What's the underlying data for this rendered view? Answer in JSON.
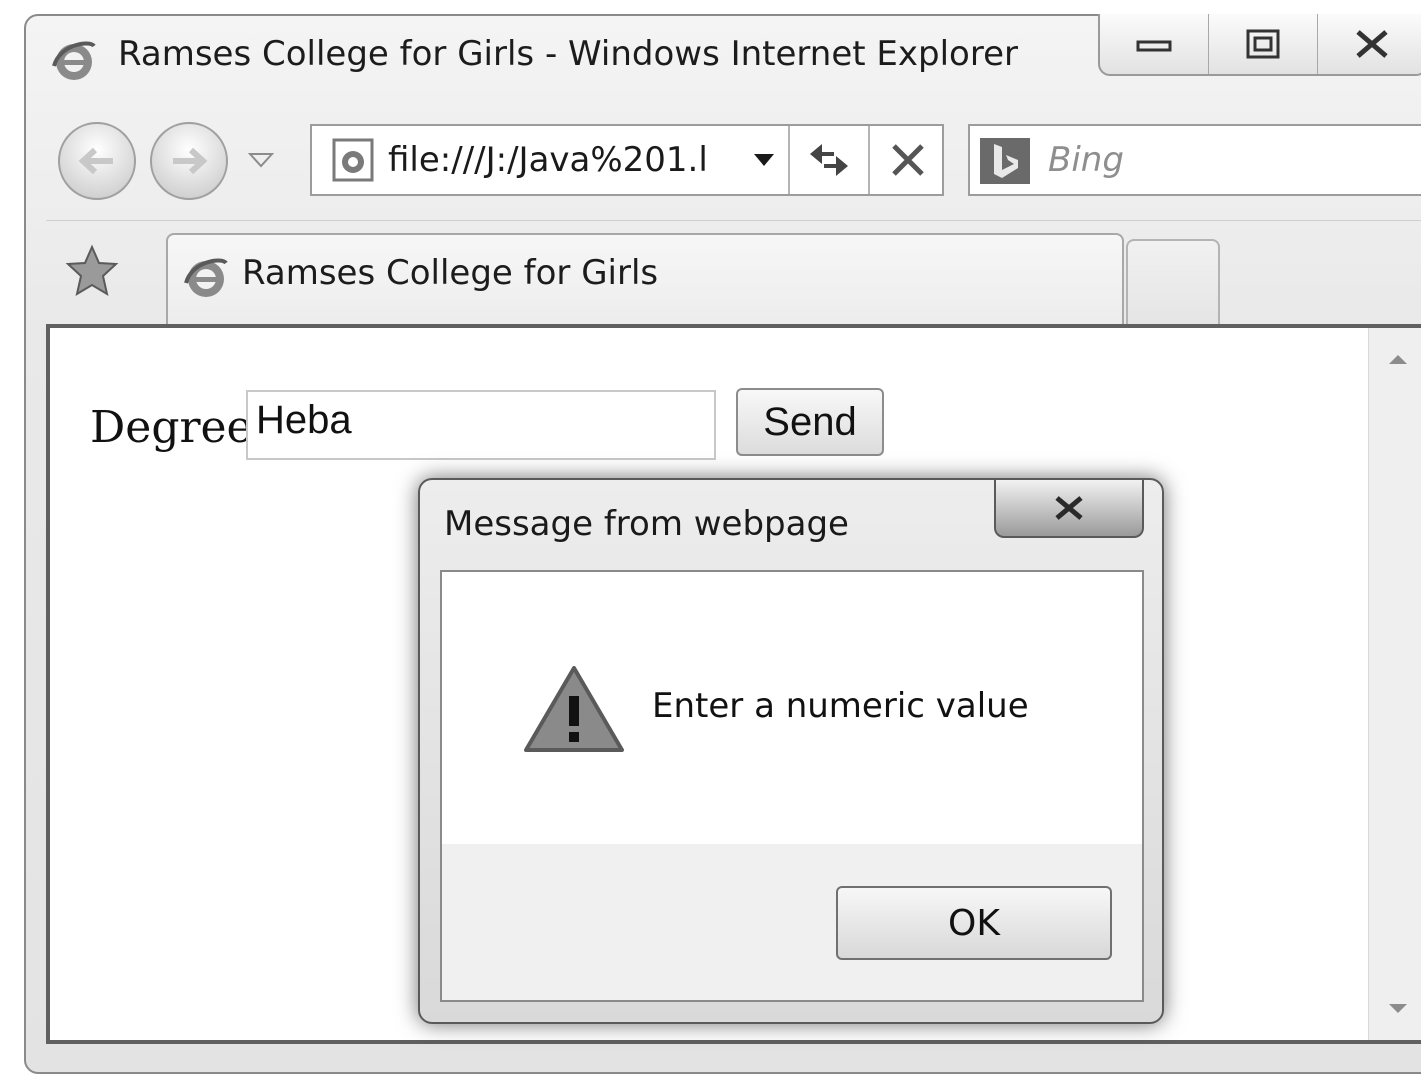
{
  "window": {
    "title": "Ramses College for Girls - Windows Internet Explorer",
    "icon": "ie-icon",
    "caption_buttons": [
      "minimize-icon",
      "restore-icon",
      "close-icon"
    ]
  },
  "navigation": {
    "back_icon": "back-arrow-icon",
    "forward_icon": "forward-arrow-icon",
    "address": "file:///J:/Java%201.l",
    "search_placeholder": "Bing",
    "search_provider_icon": "bing-icon"
  },
  "tabs": {
    "favorites_icon": "favorites-star-icon",
    "active_tab_label": "Ramses College for Girls"
  },
  "page": {
    "degree_label": "Degree",
    "degree_value": "Heba",
    "send_label": "Send"
  },
  "dialog": {
    "title": "Message from webpage",
    "message": "Enter a numeric value",
    "ok_label": "OK",
    "icon": "warning-icon"
  }
}
